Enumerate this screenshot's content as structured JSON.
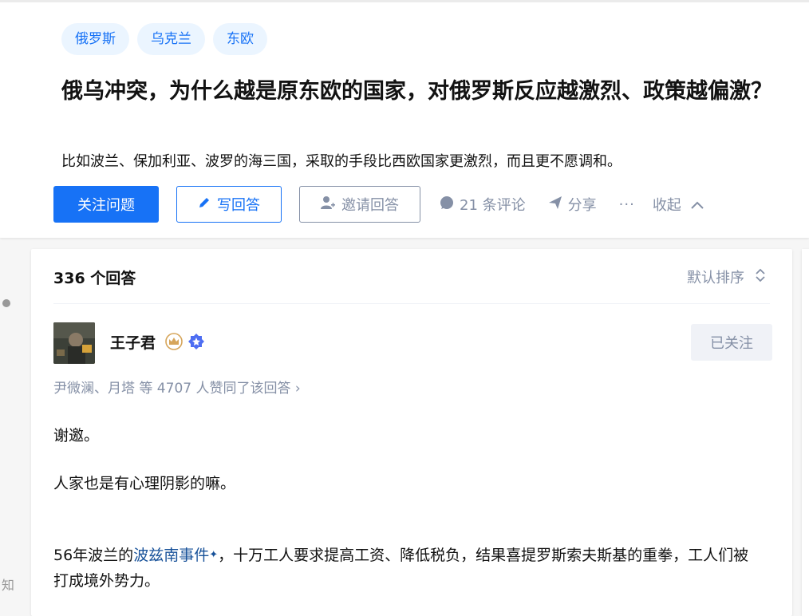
{
  "question": {
    "tags": [
      "俄罗斯",
      "乌克兰",
      "东欧"
    ],
    "title": "俄乌冲突，为什么越是原东欧的国家，对俄罗斯反应越激烈、政策越偏激？",
    "detail": "比如波兰、保加利亚、波罗的海三国，采取的手段比西欧国家更激烈，而且更不愿调和。"
  },
  "actions": {
    "follow": "关注问题",
    "write": "写回答",
    "invite": "邀请回答",
    "comments": "21 条评论",
    "share": "分享",
    "more": "···",
    "collapse": "收起"
  },
  "answers": {
    "count": "336 个回答",
    "sort": "默认排序"
  },
  "answer": {
    "author": "王子君",
    "follow_status": "已关注",
    "voters": "尹微澜、月塔 等 4707 人赞同了该回答 ›",
    "p1": "谢邀。",
    "p2": "人家也是有心理阴影的嘛。",
    "p3_prefix": "56年波兰的",
    "p3_link": "波兹南事件",
    "p3_spark": "✦",
    "p3_suffix": "，十万工人要求提高工资、降低税负，结果喜提罗斯索夫斯基的重拳，工人们被打成境外势力。"
  },
  "side": {
    "text": "知"
  },
  "colors": {
    "accent": "#1772f6",
    "muted": "#8590a6",
    "link": "#175199"
  },
  "icons": [
    "pen-icon",
    "invite-user-icon",
    "comment-icon",
    "share-icon",
    "chevron-up-icon",
    "sort-icon",
    "crown-badge-icon",
    "verified-badge-icon"
  ]
}
